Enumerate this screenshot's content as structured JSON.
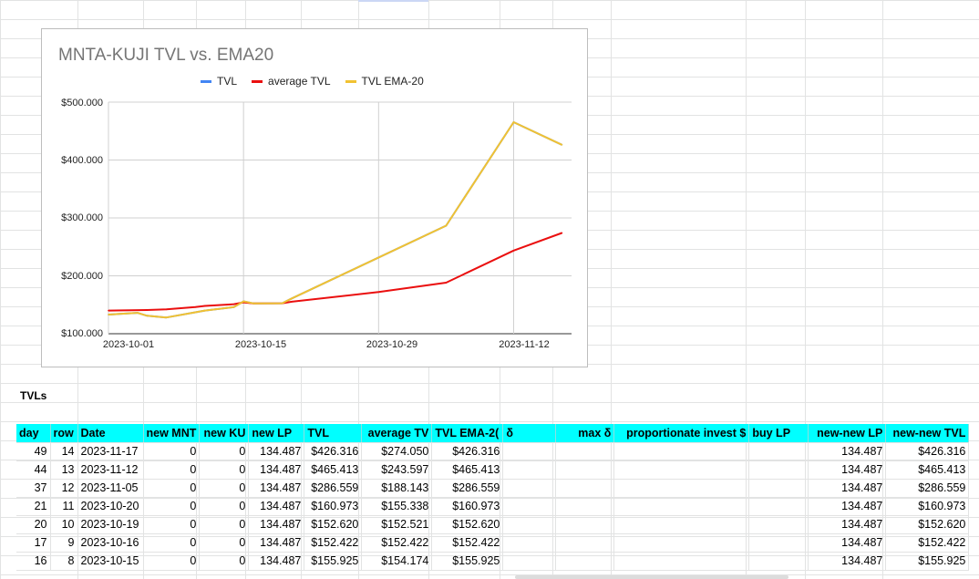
{
  "chart": {
    "title": "MNTA-KUJI TVL vs. EMA20",
    "legend": [
      {
        "name": "TVL",
        "color": "#4285f4"
      },
      {
        "name": "average TVL",
        "color": "#ea0f0f"
      },
      {
        "name": "TVL EMA-20",
        "color": "#f1c232"
      }
    ],
    "y_ticks": [
      "$500.000",
      "$400.000",
      "$300.000",
      "$200.000",
      "$100.000"
    ],
    "x_ticks": [
      "2023-10-01",
      "2023-10-15",
      "2023-10-29",
      "2023-11-12"
    ]
  },
  "chart_data": {
    "type": "line",
    "title": "MNTA-KUJI TVL vs. EMA20",
    "ylim": [
      100000,
      500000
    ],
    "grid": true,
    "legend_position": "top",
    "series": [
      {
        "name": "TVL",
        "color": "#4285f4",
        "x": [
          "2023-10-01",
          "2023-10-04",
          "2023-10-05",
          "2023-10-07",
          "2023-10-10",
          "2023-10-11",
          "2023-10-14",
          "2023-10-15",
          "2023-10-16",
          "2023-10-19",
          "2023-10-20",
          "2023-11-05",
          "2023-11-12",
          "2023-11-17"
        ],
        "values": [
          133000,
          136000,
          131000,
          128000,
          137000,
          140000,
          146000,
          155925,
          152422,
          152620,
          160973,
          286559,
          465413,
          426316
        ]
      },
      {
        "name": "average TVL",
        "color": "#ea0f0f",
        "x": [
          "2023-10-01",
          "2023-10-05",
          "2023-10-07",
          "2023-10-10",
          "2023-10-11",
          "2023-10-14",
          "2023-10-15",
          "2023-10-16",
          "2023-10-19",
          "2023-10-20",
          "2023-10-29",
          "2023-11-05",
          "2023-11-12",
          "2023-11-17"
        ],
        "values": [
          140000,
          141000,
          142000,
          146000,
          148000,
          151000,
          154174,
          152422,
          152521,
          155338,
          172000,
          188143,
          243597,
          274050
        ]
      },
      {
        "name": "TVL EMA-20",
        "color": "#f1c232",
        "x": [
          "2023-10-01",
          "2023-10-04",
          "2023-10-05",
          "2023-10-07",
          "2023-10-10",
          "2023-10-11",
          "2023-10-14",
          "2023-10-15",
          "2023-10-16",
          "2023-10-19",
          "2023-10-20",
          "2023-11-05",
          "2023-11-12",
          "2023-11-17"
        ],
        "values": [
          133000,
          136000,
          131000,
          128000,
          137000,
          140000,
          146000,
          155925,
          152422,
          152620,
          160973,
          286559,
          465413,
          426316
        ]
      }
    ]
  },
  "sheet": {
    "section_label": "TVLs",
    "headers": [
      "day",
      "row",
      "Date",
      "new MNT",
      "new KU",
      "new LP",
      "TVL",
      "average TV",
      "TVL EMA-2(",
      "δ",
      "max δ",
      "proportionate invest $",
      "buy LP",
      "new-new LP",
      "new-new TVL"
    ],
    "rows": [
      [
        "49",
        "14",
        "2023-11-17",
        "0",
        "0",
        "134.487",
        "$426.316",
        "$274.050",
        "$426.316",
        "",
        "",
        "",
        "",
        "134.487",
        "$426.316"
      ],
      [
        "44",
        "13",
        "2023-11-12",
        "0",
        "0",
        "134.487",
        "$465.413",
        "$243.597",
        "$465.413",
        "",
        "",
        "",
        "",
        "134.487",
        "$465.413"
      ],
      [
        "37",
        "12",
        "2023-11-05",
        "0",
        "0",
        "134.487",
        "$286.559",
        "$188.143",
        "$286.559",
        "",
        "",
        "",
        "",
        "134.487",
        "$286.559"
      ],
      [
        "21",
        "11",
        "2023-10-20",
        "0",
        "0",
        "134.487",
        "$160.973",
        "$155.338",
        "$160.973",
        "",
        "",
        "",
        "",
        "134.487",
        "$160.973"
      ],
      [
        "20",
        "10",
        "2023-10-19",
        "0",
        "0",
        "134.487",
        "$152.620",
        "$152.521",
        "$152.620",
        "",
        "",
        "",
        "",
        "134.487",
        "$152.620"
      ],
      [
        "17",
        "9",
        "2023-10-16",
        "0",
        "0",
        "134.487",
        "$152.422",
        "$152.422",
        "$152.422",
        "",
        "",
        "",
        "",
        "134.487",
        "$152.422"
      ],
      [
        "16",
        "8",
        "2023-10-15",
        "0",
        "0",
        "134.487",
        "$155.925",
        "$154.174",
        "$155.925",
        "",
        "",
        "",
        "",
        "134.487",
        "$155.925"
      ]
    ]
  }
}
